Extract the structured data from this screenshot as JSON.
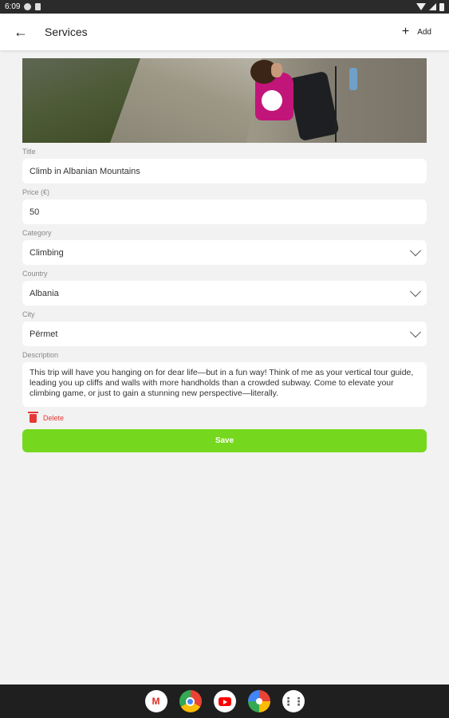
{
  "status_bar": {
    "time": "6:09"
  },
  "app_bar": {
    "title": "Services",
    "add_label": "Add"
  },
  "form": {
    "title_label": "Title",
    "title_value": "Climb in Albanian Mountains",
    "price_label": "Price (€)",
    "price_value": "50",
    "category_label": "Category",
    "category_value": "Climbing",
    "country_label": "Country",
    "country_value": "Albania",
    "city_label": "City",
    "city_value": "Përmet",
    "description_label": "Description",
    "description_value": "This trip will have you hanging on for dear life—but in a fun way! Think of me as your vertical tour guide, leading you up cliffs and walls with more handholds than a crowded subway. Come to elevate your climbing game, or just to gain a stunning new perspective—literally.",
    "delete_label": "Delete",
    "save_label": "Save"
  },
  "colors": {
    "accent": "#76d81e",
    "danger": "#e53935",
    "background": "#f2f2f2"
  },
  "nav_apps": [
    "gmail-icon",
    "chrome-icon",
    "youtube-icon",
    "photos-icon",
    "app-drawer-icon"
  ]
}
